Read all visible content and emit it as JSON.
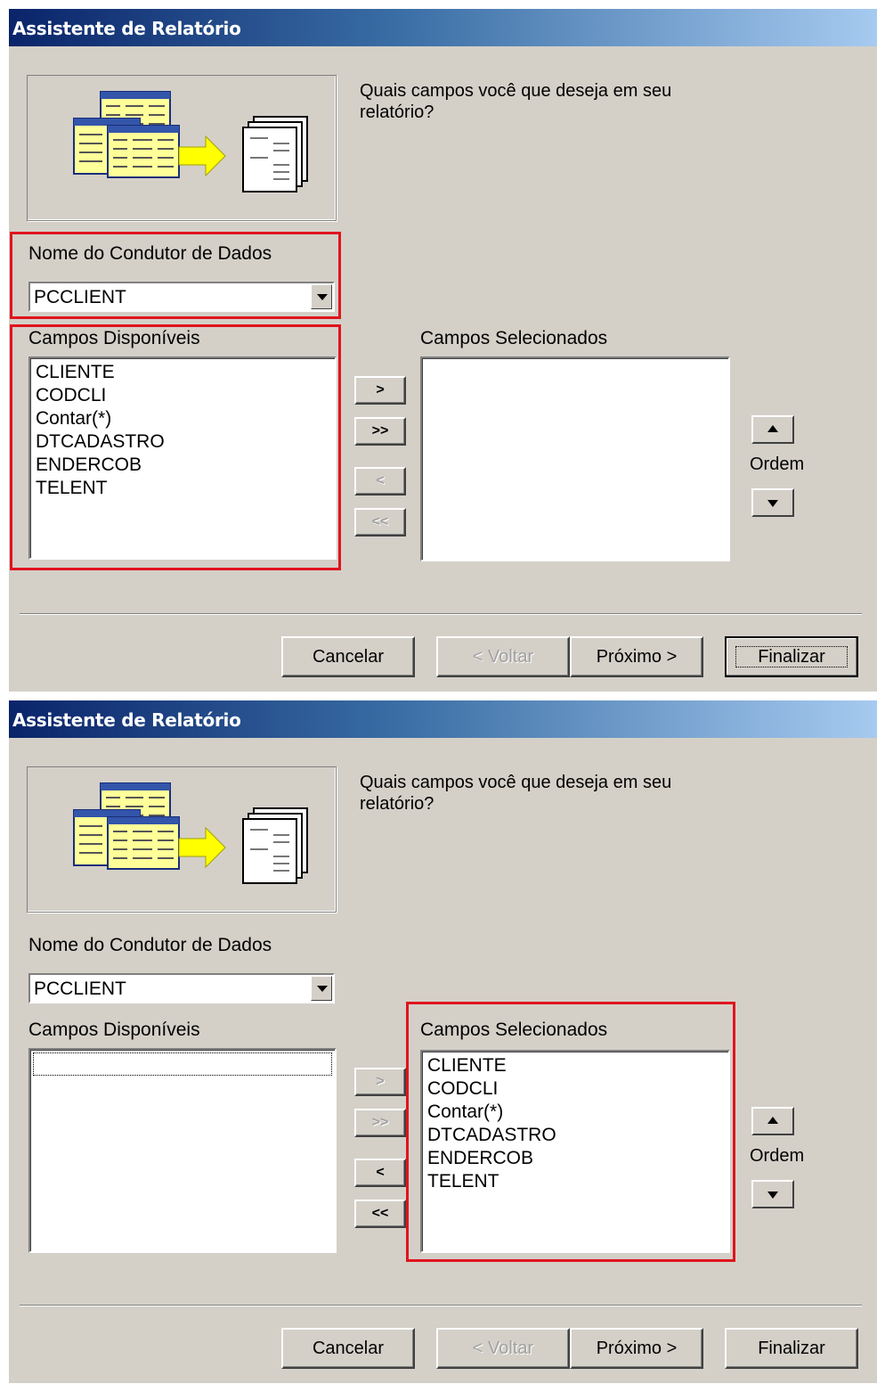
{
  "dialogs": [
    {
      "title": "Assistente de Relatório",
      "prompt": "Quais campos você que deseja em seu relatório?",
      "datasource_label": "Nome do Condutor de Dados",
      "datasource_value": "PCCLIENT",
      "available_label": "Campos Disponíveis",
      "available_items": [
        "CLIENTE",
        "CODCLI",
        "Contar(*)",
        "DTCADASTRO",
        "ENDERCOB",
        "TELENT"
      ],
      "selected_label": "Campos Selecionados",
      "selected_items": [],
      "move_buttons": [
        ">",
        ">>",
        "<",
        "<<"
      ],
      "order_label": "Ordem",
      "footer": {
        "cancel": "Cancelar",
        "back": "< Voltar",
        "next": "Próximo >",
        "finish": "Finalizar"
      }
    },
    {
      "title": "Assistente de Relatório",
      "prompt": "Quais campos você que deseja em seu relatório?",
      "datasource_label": "Nome do Condutor de Dados",
      "datasource_value": "PCCLIENT",
      "available_label": "Campos Disponíveis",
      "available_items": [],
      "selected_label": "Campos Selecionados",
      "selected_items": [
        "CLIENTE",
        "CODCLI",
        "Contar(*)",
        "DTCADASTRO",
        "ENDERCOB",
        "TELENT"
      ],
      "move_buttons": [
        ">",
        ">>",
        "<",
        "<<"
      ],
      "order_label": "Ordem",
      "footer": {
        "cancel": "Cancelar",
        "back": "< Voltar",
        "next": "Próximo >",
        "finish": "Finalizar"
      }
    }
  ],
  "colors": {
    "dialog_bg": "#d4d0c8",
    "title_start": "#0a246a",
    "title_end": "#a6caf0",
    "highlight": "#e0141e"
  }
}
